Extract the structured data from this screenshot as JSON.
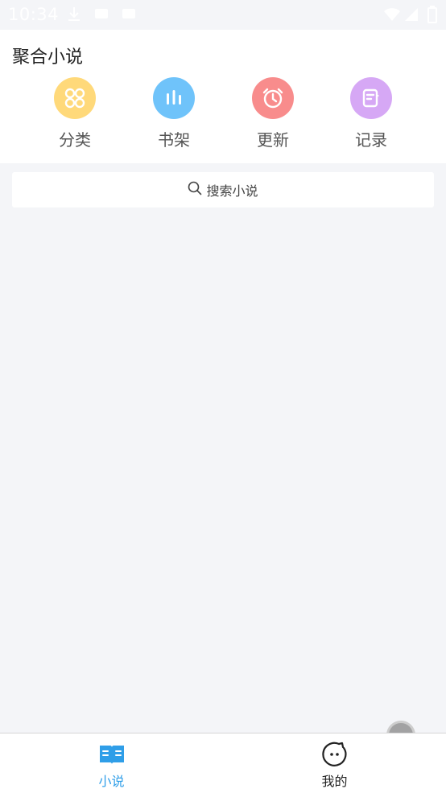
{
  "status_bar": {
    "time": "10:34"
  },
  "header": {
    "title": "聚合小说",
    "quick_actions": [
      {
        "label": "分类",
        "icon": "category-icon",
        "color": "#ffd97a"
      },
      {
        "label": "书架",
        "icon": "bookshelf-icon",
        "color": "#6fc3fa"
      },
      {
        "label": "更新",
        "icon": "alarm-clock-icon",
        "color": "#f88c8c"
      },
      {
        "label": "记录",
        "icon": "history-icon",
        "color": "#d6a8f5"
      }
    ]
  },
  "search": {
    "placeholder": "搜索小说"
  },
  "bottom_nav": {
    "tabs": [
      {
        "label": "小说",
        "icon": "book-icon",
        "active": true,
        "color": "#2f9ee8"
      },
      {
        "label": "我的",
        "icon": "face-icon",
        "active": false,
        "color": "#222222"
      }
    ]
  }
}
